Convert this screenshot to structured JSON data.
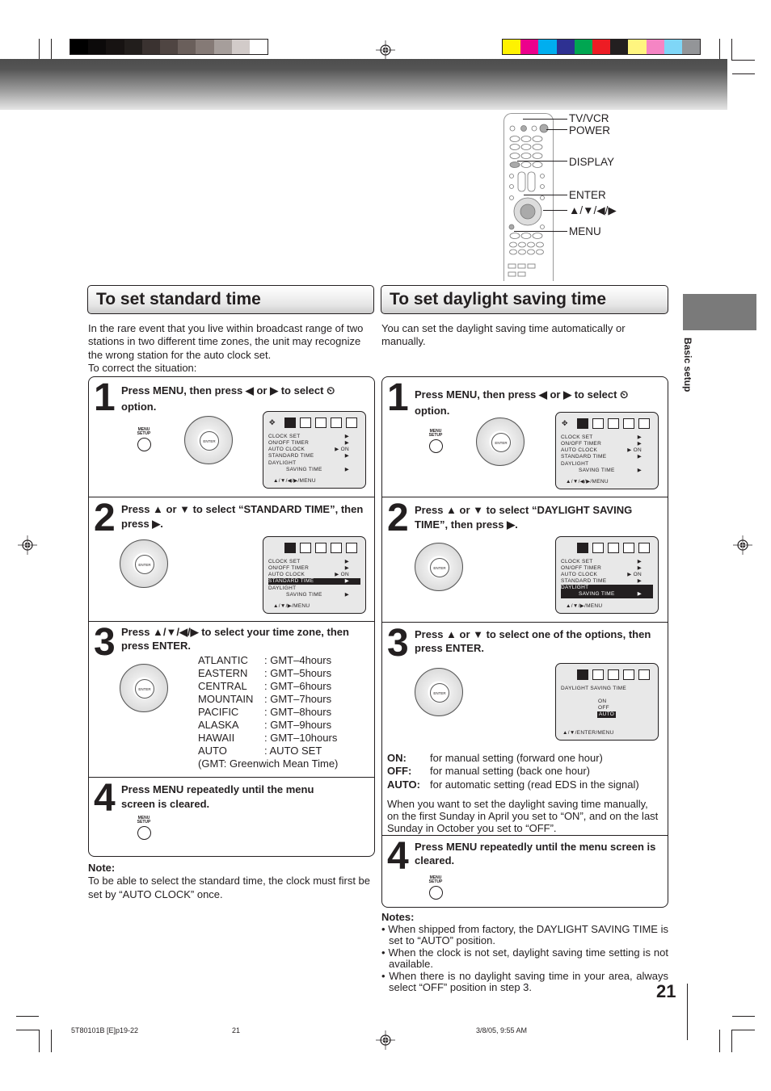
{
  "calibration": {
    "grayscale": [
      "#000000",
      "#0c0a0a",
      "#171312",
      "#221e1c",
      "#3a3230",
      "#4f4542",
      "#6a5f5b",
      "#857a76",
      "#a69e9b",
      "#d2cbc9",
      "#ffffff"
    ],
    "colors": [
      "#fff200",
      "#ec008c",
      "#00aeef",
      "#2e3192",
      "#00a651",
      "#ed1c24",
      "#231f20",
      "#fff57f",
      "#f585c4",
      "#7fd6f7",
      "#939598"
    ]
  },
  "remote": {
    "labels": [
      "TV/VCR",
      "POWER",
      "DISPLAY",
      "ENTER",
      "▲/▼/◀/▶",
      "MENU"
    ]
  },
  "side_tab": {
    "label": "Basic setup"
  },
  "left": {
    "title": "To set standard time",
    "intro": [
      "In the rare event that you live within broadcast range of two",
      "stations in two different time zones, the unit may recognize",
      "the wrong station for the auto clock set.",
      "To correct the situation:"
    ],
    "steps": [
      {
        "num": "1",
        "text": "Press MENU, then press ◀ or ▶ to select ⏲ option."
      },
      {
        "num": "2",
        "text": "Press ▲ or ▼ to select “STANDARD TIME”, then press ▶."
      },
      {
        "num": "3",
        "text": "Press ▲/▼/◀/▶ to select your time zone, then press ENTER."
      },
      {
        "num": "4",
        "text": "Press MENU repeatedly until the menu screen is cleared."
      }
    ],
    "time_zones": [
      {
        "zone": "ATLANTIC",
        "value": ": GMT–4hours"
      },
      {
        "zone": "EASTERN",
        "value": ": GMT–5hours"
      },
      {
        "zone": "CENTRAL",
        "value": ": GMT–6hours"
      },
      {
        "zone": "MOUNTAIN",
        "value": ": GMT–7hours"
      },
      {
        "zone": "PACIFIC",
        "value": ": GMT–8hours"
      },
      {
        "zone": "ALASKA",
        "value": ": GMT–9hours"
      },
      {
        "zone": "HAWAII",
        "value": ": GMT–10hours"
      },
      {
        "zone": "AUTO",
        "value": ": AUTO SET"
      }
    ],
    "gmt_note": "(GMT: Greenwich Mean Time)",
    "note_title": "Note:",
    "note_text": "To be able to select the standard time, the clock must first be set by “AUTO CLOCK” once."
  },
  "right": {
    "title": "To set daylight saving time",
    "intro": "You can set the daylight saving time automatically or manually.",
    "steps": [
      {
        "num": "1",
        "text": "Press MENU, then press ◀ or ▶ to select ⏲ option."
      },
      {
        "num": "2",
        "text": "Press ▲ or ▼ to select “DAYLIGHT SAVING TIME”, then press ▶."
      },
      {
        "num": "3",
        "text": "Press ▲ or ▼ to select one of the options, then press ENTER."
      },
      {
        "num": "4",
        "text": "Press MENU repeatedly until the menu screen is cleared."
      }
    ],
    "options": [
      {
        "key": "ON:",
        "desc": "for manual setting (forward one hour)"
      },
      {
        "key": "OFF:",
        "desc": "for manual setting (back one hour)"
      },
      {
        "key": "AUTO:",
        "desc": "for automatic setting (read EDS in the signal)"
      }
    ],
    "manual_text": "When you want to set the daylight saving time manually, on the first Sunday in April you set to “ON”, and on the last Sunday in October you set to “OFF”.",
    "notes_title": "Notes:",
    "notes": [
      "When shipped from factory, the DAYLIGHT SAVING TIME is set to “AUTO” position.",
      "When the clock is not set, daylight saving time setting is not available.",
      "When there is no daylight saving time in your area, always select “OFF” position in step 3."
    ]
  },
  "osd": {
    "menu_rows": [
      "CLOCK SET",
      "ON/OFF TIMER",
      "AUTO CLOCK",
      "STANDARD TIME",
      "DAYLIGHT",
      "SAVING TIME"
    ],
    "auto_clock_value": "ON",
    "footer_full": "▲/▼/◀/▶/MENU",
    "footer_short": "▲/▼/▶/MENU",
    "dst_title": "DAYLIGHT SAVING TIME",
    "dst_options": [
      "ON",
      "OFF",
      "AUTO"
    ],
    "dst_selected": "AUTO",
    "dst_footer": "▲/▼/ENTER/MENU"
  },
  "buttons": {
    "enter": "ENTER",
    "menu_line1": "MENU",
    "menu_line2": "SETUP"
  },
  "page_number": "21",
  "footer": {
    "file": "5T80101B [E]p19-22",
    "page": "21",
    "date": "3/8/05, 9:55 AM"
  }
}
